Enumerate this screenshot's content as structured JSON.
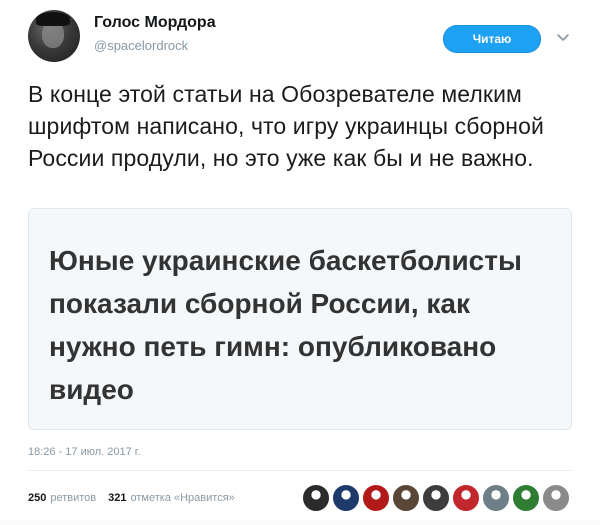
{
  "author": {
    "display_name": "Голос Мордора",
    "handle": "@spacelordrock"
  },
  "follow_button": {
    "label": "Читаю",
    "color": "#1da1f2"
  },
  "tweet": {
    "text": "В конце этой статьи на Обозревателе мелким шрифтом написано, что игру украинцы сборной России продули, но это уже как бы и не важно."
  },
  "card": {
    "title": "Юные украинские баскетболисты показали сборной России, как нужно петь гимн: опубликовано видео"
  },
  "timestamp": "18:26 - 17 июл. 2017 г.",
  "stats": {
    "retweets_count": "250",
    "retweets_label": "ретвитов",
    "likes_count": "321",
    "likes_label": "отметка «Нравится»"
  },
  "likers": [
    {
      "icon": "user-avatar-icon",
      "color": "#2b2b2b"
    },
    {
      "icon": "user-avatar-icon",
      "color": "#1e3a6b"
    },
    {
      "icon": "user-avatar-icon",
      "color": "#b31b1b"
    },
    {
      "icon": "user-avatar-icon",
      "color": "#5a4636"
    },
    {
      "icon": "user-avatar-icon",
      "color": "#3d3d3d"
    },
    {
      "icon": "user-avatar-icon",
      "color": "#c1272d"
    },
    {
      "icon": "user-avatar-icon",
      "color": "#6f7f88"
    },
    {
      "icon": "user-avatar-icon",
      "color": "#2e7d32"
    },
    {
      "icon": "user-avatar-icon",
      "color": "#8a8a8a"
    }
  ]
}
